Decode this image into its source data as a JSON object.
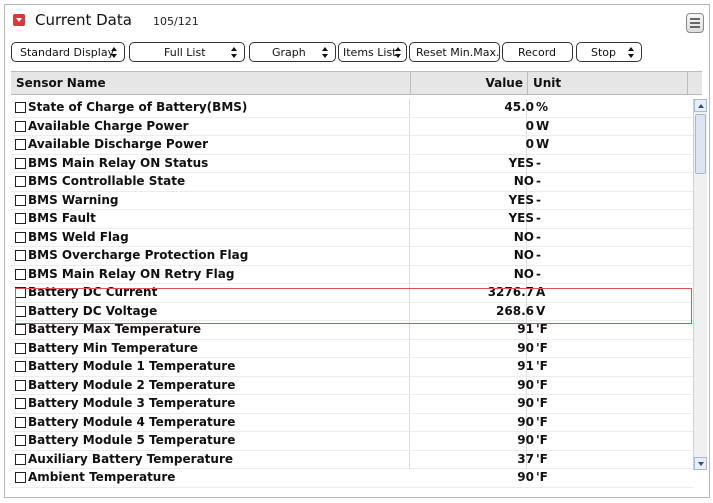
{
  "window": {
    "title": "Current Data",
    "count": "105/121"
  },
  "toolbar": {
    "display_mode": "Standard Display",
    "list_mode": "Full List",
    "graph": "Graph",
    "items_list": "Items List",
    "reset": "Reset Min.Max.",
    "record": "Record",
    "stop": "Stop"
  },
  "table": {
    "headers": {
      "name": "Sensor Name",
      "value": "Value",
      "unit": "Unit"
    },
    "rows": [
      {
        "name": "State of Charge of Battery(BMS)",
        "value": "45.0",
        "unit": "%"
      },
      {
        "name": "Available Charge Power",
        "value": "0",
        "unit": "W"
      },
      {
        "name": "Available Discharge Power",
        "value": "0",
        "unit": "W"
      },
      {
        "name": "BMS Main Relay ON Status",
        "value": "YES",
        "unit": "-"
      },
      {
        "name": "BMS Controllable State",
        "value": "NO",
        "unit": "-"
      },
      {
        "name": "BMS Warning",
        "value": "YES",
        "unit": "-"
      },
      {
        "name": "BMS Fault",
        "value": "YES",
        "unit": "-"
      },
      {
        "name": "BMS Weld Flag",
        "value": "NO",
        "unit": "-"
      },
      {
        "name": "BMS Overcharge Protection Flag",
        "value": "NO",
        "unit": "-"
      },
      {
        "name": "BMS Main Relay ON Retry Flag",
        "value": "NO",
        "unit": "-"
      },
      {
        "name": "Battery DC Current",
        "value": "3276.7",
        "unit": "A"
      },
      {
        "name": "Battery DC Voltage",
        "value": "268.6",
        "unit": "V"
      },
      {
        "name": "Battery Max Temperature",
        "value": "91",
        "unit": "'F"
      },
      {
        "name": "Battery Min Temperature",
        "value": "90",
        "unit": "'F"
      },
      {
        "name": "Battery Module 1 Temperature",
        "value": "91",
        "unit": "'F"
      },
      {
        "name": "Battery Module 2 Temperature",
        "value": "90",
        "unit": "'F"
      },
      {
        "name": "Battery Module 3 Temperature",
        "value": "90",
        "unit": "'F"
      },
      {
        "name": "Battery Module 4 Temperature",
        "value": "90",
        "unit": "'F"
      },
      {
        "name": "Battery Module 5 Temperature",
        "value": "90",
        "unit": "'F"
      },
      {
        "name": "Auxiliary Battery Temperature",
        "value": "37",
        "unit": "'F"
      },
      {
        "name": "Ambient Temperature",
        "value": "90",
        "unit": "'F"
      }
    ]
  },
  "icons": {
    "title": "dropdown-icon",
    "menu": "menu-icon"
  },
  "colors": {
    "accent": "#d63a3a",
    "highlight_border": "#e05050"
  }
}
